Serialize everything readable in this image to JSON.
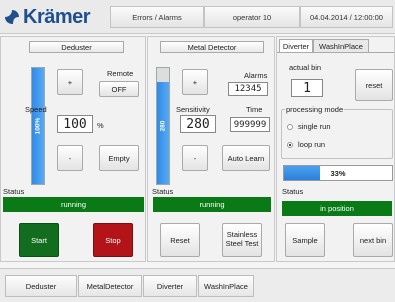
{
  "header": {
    "logo_text": "Krämer",
    "section": "Errors / Alarms",
    "user": "operator 10",
    "datetime": "04.04.2014 / 12:00:00"
  },
  "deduster": {
    "title": "Deduster",
    "level_percent": 100,
    "level_label": "100%",
    "plus_label": "+",
    "minus_label": "-",
    "remote_label": "Remote",
    "remote_value": "OFF",
    "speed_label": "Speed",
    "speed_value": "100",
    "speed_unit": "%",
    "empty_label": "Empty",
    "status_label": "Status",
    "status_value": "running",
    "start_label": "Start",
    "stop_label": "Stop"
  },
  "metal_detector": {
    "title": "Metal Detector",
    "level_percent": 88,
    "level_label": "280",
    "plus_label": "+",
    "minus_label": "-",
    "alarms_label": "Alarms",
    "alarms_value": "12345",
    "sensitivity_label": "Sensitivity",
    "sensitivity_value": "280",
    "time_label": "Time",
    "time_value": "999999",
    "auto_learn_label": "Auto Learn",
    "status_label": "Status",
    "status_value": "running",
    "reset_label": "Reset",
    "stainless_label": "Stainless Steel Test"
  },
  "diverter": {
    "tabs": [
      "Diverter",
      "WashInPlace"
    ],
    "active_tab": "Diverter",
    "actual_bin_label": "actual bin",
    "actual_bin_value": "1",
    "reset_label": "reset",
    "mode_label": "processing mode",
    "mode_options": [
      "single run",
      "loop run"
    ],
    "mode_selected": "loop run",
    "progress_percent": 33,
    "progress_label": "33%",
    "status_label": "Status",
    "status_value": "in position",
    "sample_label": "Sample",
    "next_bin_label": "next bin"
  },
  "bottom_nav": [
    "Deduster",
    "MetalDetector",
    "Diverter",
    "WashInPlace"
  ],
  "colors": {
    "status_green": "#0a7a17",
    "start_green": "#126e1e",
    "stop_red": "#b2141a",
    "level_blue": "#2e8be8",
    "logo_blue": "#1f4f8f"
  }
}
